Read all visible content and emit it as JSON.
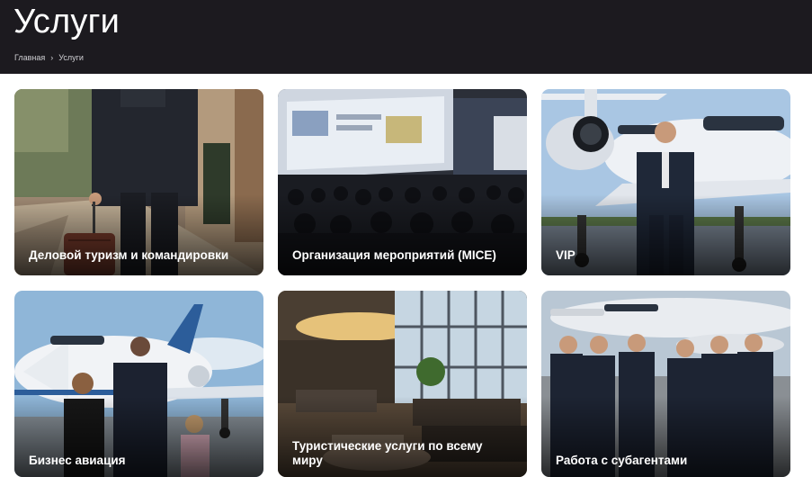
{
  "page": {
    "title": "Услуги"
  },
  "breadcrumb": {
    "home": "Главная",
    "separator": "›",
    "current": "Услуги"
  },
  "services": [
    {
      "label": "Деловой туризм и командировки",
      "image": "businessman-with-suitcase"
    },
    {
      "label": "Организация мероприятий (MICE)",
      "image": "conference-audience"
    },
    {
      "label": "VIP",
      "image": "man-by-private-jet"
    },
    {
      "label": "Бизнес авиация",
      "image": "family-at-jet"
    },
    {
      "label": "Туристические услуги по всему миру",
      "image": "airport-lounge"
    },
    {
      "label": "Работа с субагентами",
      "image": "group-at-jet"
    }
  ],
  "colors": {
    "header_bg": "#1c1a1f",
    "text_light": "#ffffff"
  }
}
